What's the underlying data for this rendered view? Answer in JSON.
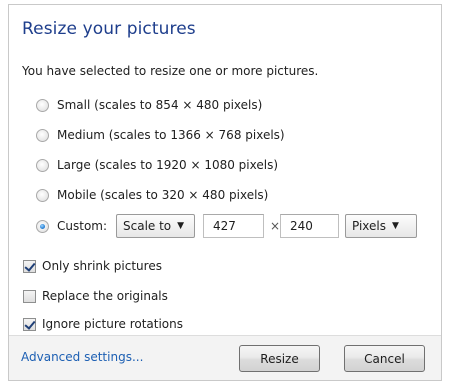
{
  "dialog": {
    "title": "Resize your pictures",
    "description": "You have selected to resize one or more pictures."
  },
  "sizes": [
    {
      "label": "Small (scales to 854 × 480 pixels)",
      "checked": false
    },
    {
      "label": "Medium (scales to 1366 × 768 pixels)",
      "checked": false
    },
    {
      "label": "Large (scales to 1920 × 1080 pixels)",
      "checked": false
    },
    {
      "label": "Mobile (scales to 320 × 480 pixels)",
      "checked": false
    }
  ],
  "custom": {
    "label": "Custom:",
    "checked": true,
    "mode_select": "Scale to",
    "width": "427",
    "separator": "×",
    "height": "240",
    "unit_select": "Pixels"
  },
  "options": [
    {
      "label": "Only shrink pictures",
      "checked": true
    },
    {
      "label": "Replace the originals",
      "checked": false
    },
    {
      "label": "Ignore picture rotations",
      "checked": true
    }
  ],
  "footer": {
    "advanced_link": "Advanced settings...",
    "resize_button": "Resize",
    "cancel_button": "Cancel"
  },
  "colors": {
    "title": "#1e3e8c",
    "link": "#1c5fb3"
  }
}
